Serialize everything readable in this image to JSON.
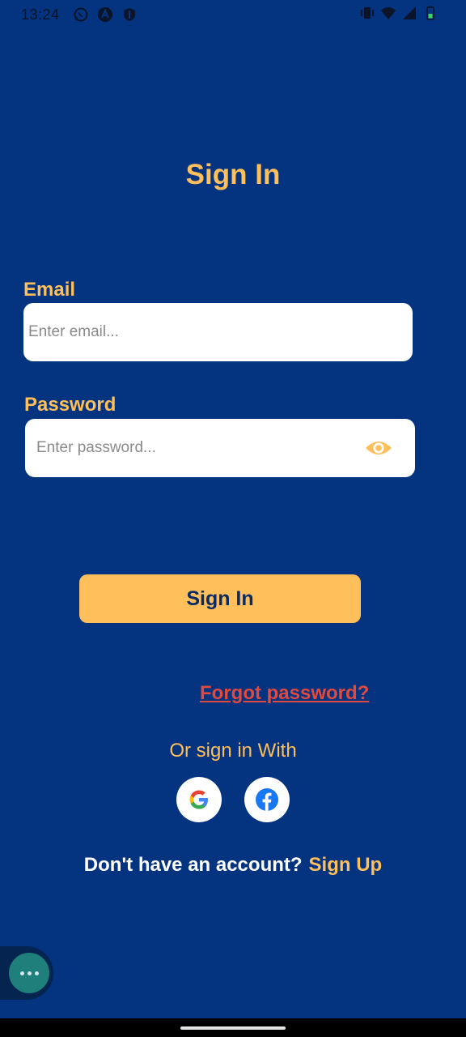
{
  "status_bar": {
    "time": "13:24",
    "left_icons": [
      "whatsapp-icon",
      "a-logo-icon",
      "shield-icon"
    ],
    "right_icons": [
      "vibrate-icon",
      "wifi-icon",
      "signal-icon",
      "battery-icon"
    ]
  },
  "page": {
    "title": "Sign In"
  },
  "email": {
    "label": "Email",
    "placeholder": "Enter email...",
    "value": ""
  },
  "password": {
    "label": "Password",
    "placeholder": "Enter password...",
    "value": "",
    "toggle_icon": "eye-icon"
  },
  "buttons": {
    "sign_in": "Sign In"
  },
  "links": {
    "forgot_password": "Forgot password?",
    "sign_up": "Sign Up"
  },
  "social": {
    "prompt": "Or sign in With",
    "providers": [
      "google-icon",
      "facebook-icon"
    ]
  },
  "signup": {
    "prompt": "Don't have an account?"
  },
  "colors": {
    "background": "#04337f",
    "accent": "#ffbf5b",
    "link_red": "#e2493f",
    "button_text": "#0a2a63"
  }
}
